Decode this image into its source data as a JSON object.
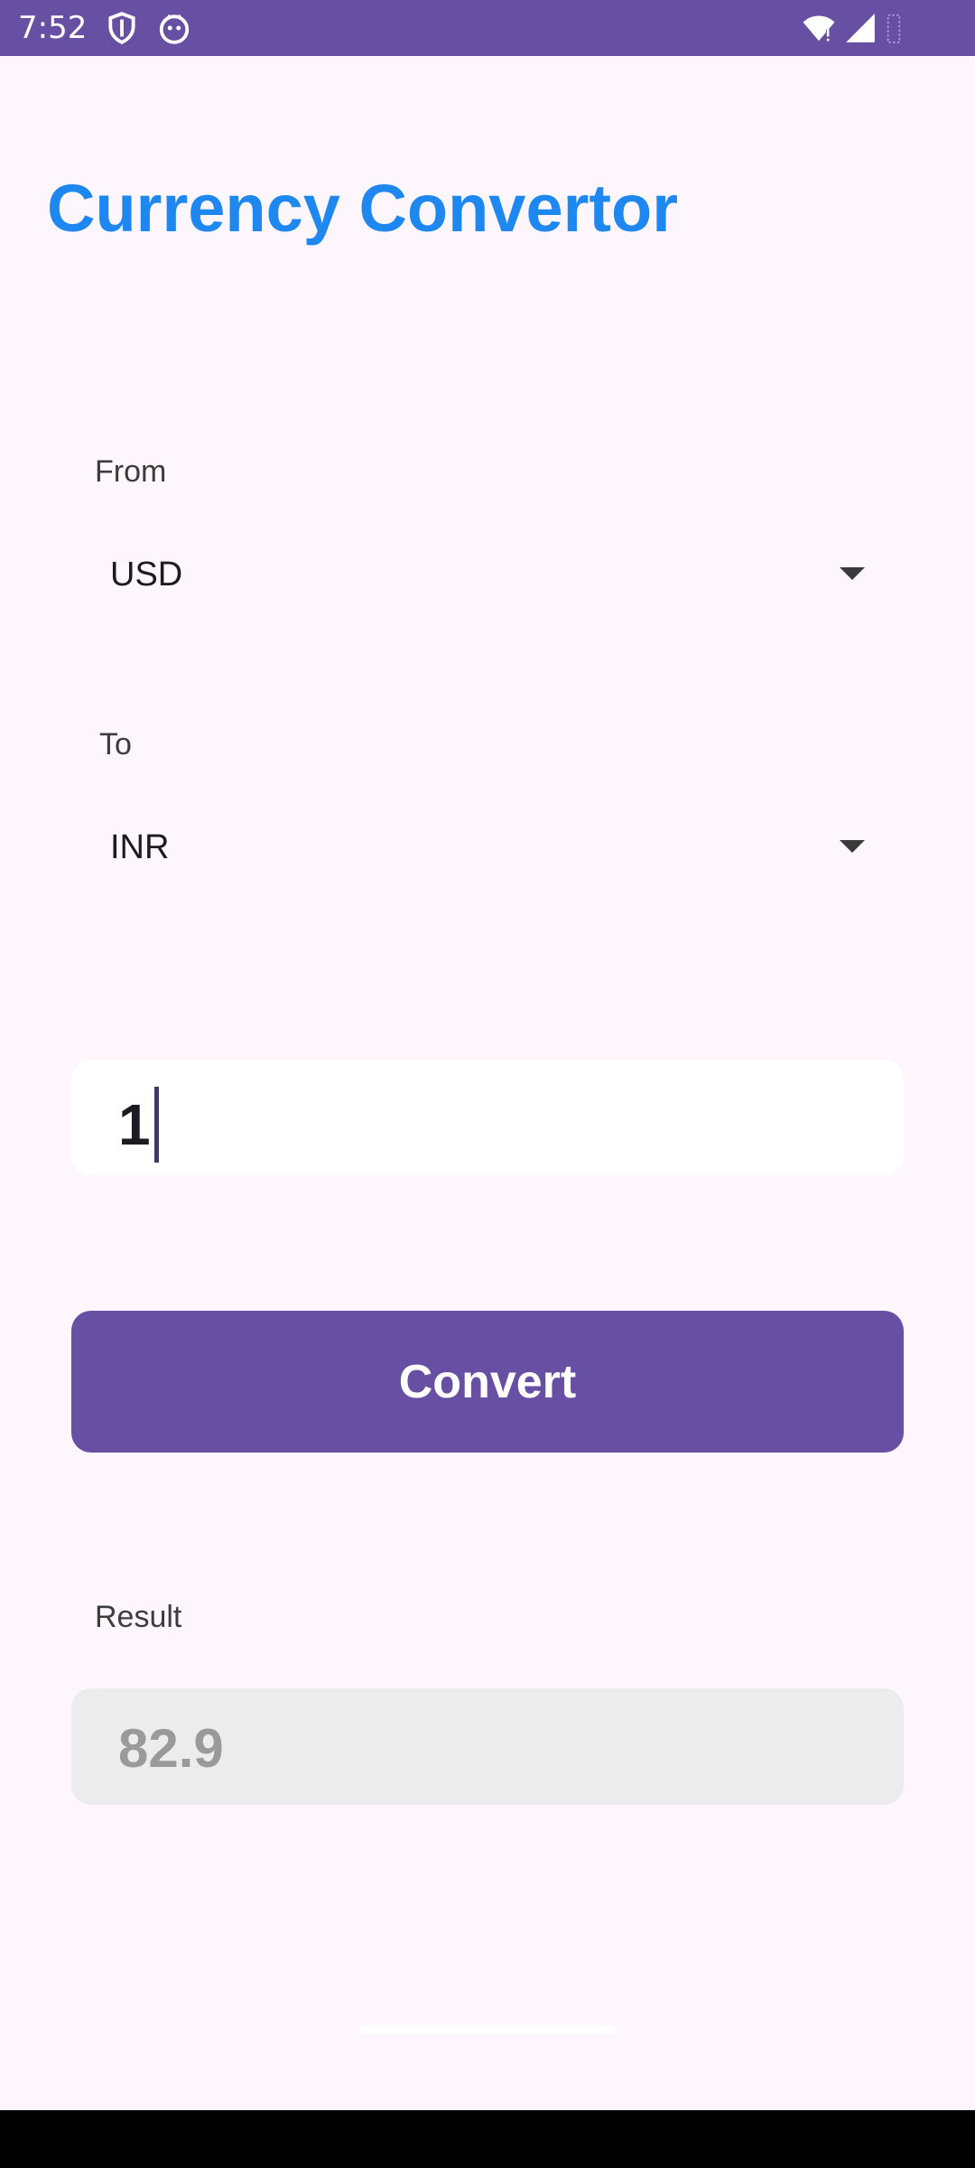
{
  "status_bar": {
    "time": "7:52",
    "icons": [
      "shield-icon",
      "face-icon",
      "wifi-icon",
      "signal-icon",
      "battery-icon"
    ],
    "background": "#6750a4"
  },
  "app": {
    "title": "Currency Convertor",
    "title_color": "#1e88f0"
  },
  "from": {
    "label": "From",
    "selected": "USD"
  },
  "to": {
    "label": "To",
    "selected": "INR"
  },
  "amount": {
    "value": "1"
  },
  "convert_button": {
    "label": "Convert",
    "color": "#6750a4"
  },
  "result": {
    "label": "Result",
    "value": "82.9"
  }
}
